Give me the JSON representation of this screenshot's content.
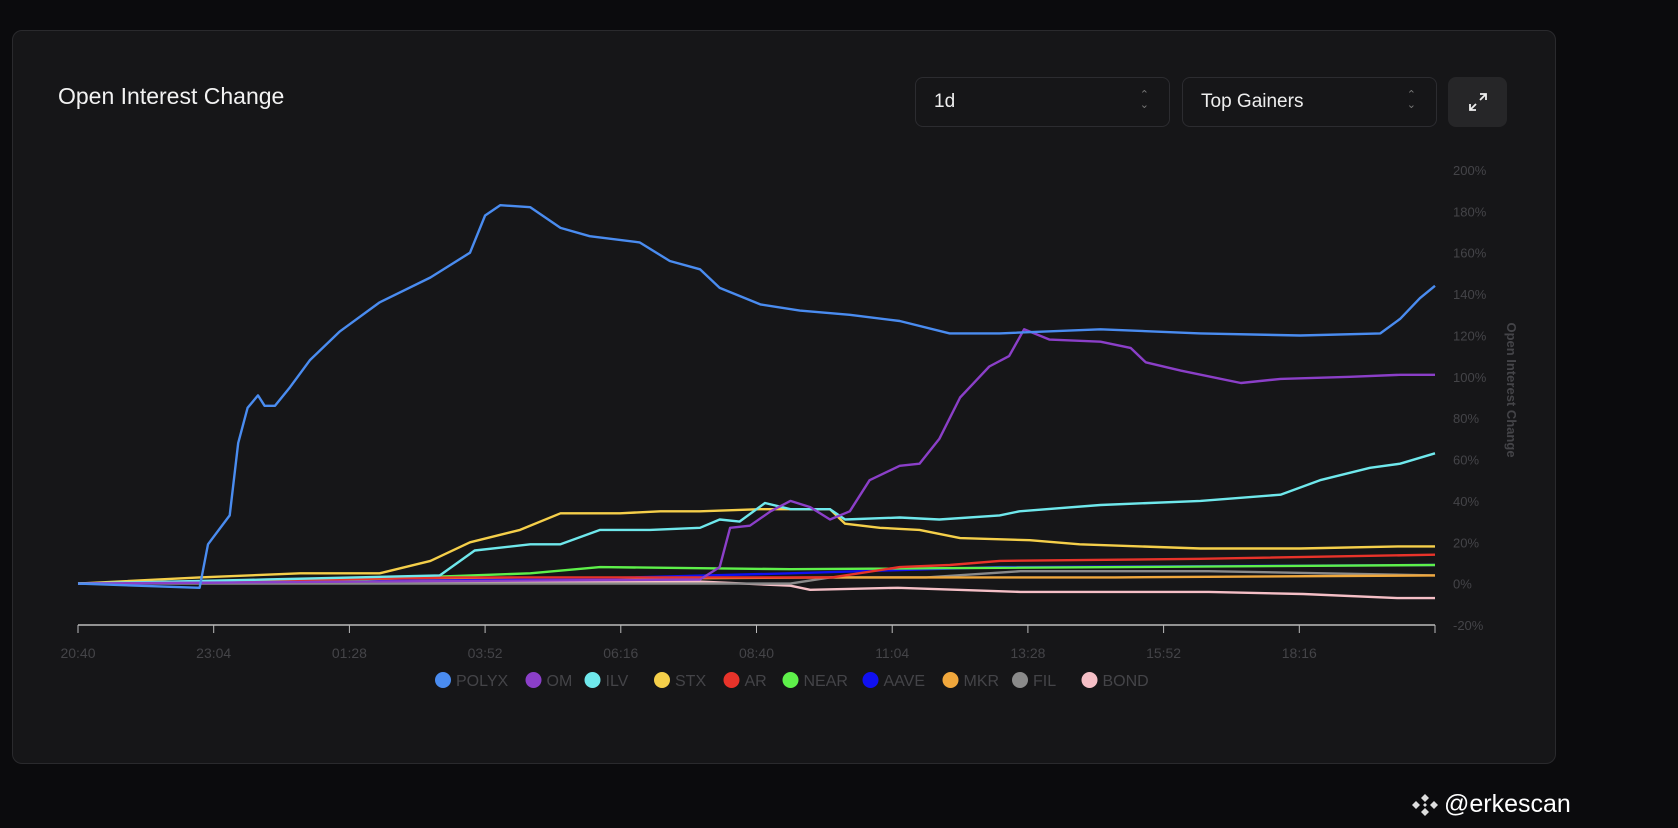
{
  "title": "Open Interest Change",
  "controls": {
    "timeframe": "1d",
    "filter": "Top Gainers"
  },
  "watermark": "@erkescan",
  "chart_data": {
    "type": "line",
    "title": "Open Interest Change",
    "ylabel": "Open Interest Change",
    "ylim": [
      -20,
      200
    ],
    "yticks": [
      "-20%",
      "0%",
      "20%",
      "40%",
      "60%",
      "80%",
      "100%",
      "120%",
      "140%",
      "160%",
      "180%",
      "200%"
    ],
    "xticks": [
      "20:40",
      "23:04",
      "01:28",
      "03:52",
      "06:16",
      "08:40",
      "11:04",
      "13:28",
      "15:52",
      "18:16"
    ],
    "xrange_minutes": [
      0,
      1440
    ],
    "legend_position": "bottom",
    "series": [
      {
        "name": "POLYX",
        "color": "#4a8cf0",
        "points": [
          [
            0,
            0
          ],
          [
            129,
            -2
          ],
          [
            138,
            19
          ],
          [
            161,
            33
          ],
          [
            170,
            68
          ],
          [
            180,
            85
          ],
          [
            191,
            91
          ],
          [
            198,
            86
          ],
          [
            209,
            86
          ],
          [
            225,
            95
          ],
          [
            246,
            108
          ],
          [
            278,
            122
          ],
          [
            320,
            136
          ],
          [
            374,
            148
          ],
          [
            416,
            160
          ],
          [
            432,
            178
          ],
          [
            448,
            183
          ],
          [
            480,
            182
          ],
          [
            512,
            172
          ],
          [
            543,
            168
          ],
          [
            596,
            165
          ],
          [
            628,
            156
          ],
          [
            660,
            152
          ],
          [
            681,
            143
          ],
          [
            724,
            135
          ],
          [
            766,
            132
          ],
          [
            819,
            130
          ],
          [
            872,
            127
          ],
          [
            925,
            121
          ],
          [
            978,
            121
          ],
          [
            1085,
            123
          ],
          [
            1191,
            121
          ],
          [
            1297,
            120
          ],
          [
            1382,
            121
          ],
          [
            1403,
            128
          ],
          [
            1424,
            138
          ],
          [
            1440,
            144
          ]
        ]
      },
      {
        "name": "OM",
        "color": "#8b3fc8",
        "points": [
          [
            0,
            0
          ],
          [
            300,
            1
          ],
          [
            660,
            2
          ],
          [
            681,
            8
          ],
          [
            692,
            27
          ],
          [
            713,
            28
          ],
          [
            735,
            35
          ],
          [
            756,
            40
          ],
          [
            777,
            37
          ],
          [
            798,
            31
          ],
          [
            819,
            35
          ],
          [
            840,
            50
          ],
          [
            872,
            57
          ],
          [
            893,
            58
          ],
          [
            914,
            70
          ],
          [
            936,
            90
          ],
          [
            967,
            105
          ],
          [
            988,
            110
          ],
          [
            1004,
            123
          ],
          [
            1031,
            118
          ],
          [
            1085,
            117
          ],
          [
            1117,
            114
          ],
          [
            1133,
            107
          ],
          [
            1170,
            103
          ],
          [
            1234,
            97
          ],
          [
            1276,
            99
          ],
          [
            1350,
            100
          ],
          [
            1403,
            101
          ],
          [
            1440,
            101
          ]
        ]
      },
      {
        "name": "ILV",
        "color": "#6fe8ec",
        "points": [
          [
            0,
            0
          ],
          [
            200,
            2
          ],
          [
            384,
            4
          ],
          [
            421,
            16
          ],
          [
            480,
            19
          ],
          [
            512,
            19
          ],
          [
            554,
            26
          ],
          [
            607,
            26
          ],
          [
            660,
            27
          ],
          [
            681,
            31
          ],
          [
            702,
            30
          ],
          [
            729,
            39
          ],
          [
            756,
            36
          ],
          [
            798,
            36
          ],
          [
            814,
            31
          ],
          [
            872,
            32
          ],
          [
            914,
            31
          ],
          [
            978,
            33
          ],
          [
            999,
            35
          ],
          [
            1085,
            38
          ],
          [
            1191,
            40
          ],
          [
            1276,
            43
          ],
          [
            1318,
            50
          ],
          [
            1371,
            56
          ],
          [
            1403,
            58
          ],
          [
            1440,
            63
          ]
        ]
      },
      {
        "name": "STX",
        "color": "#f5cf4a",
        "points": [
          [
            0,
            0
          ],
          [
            129,
            3
          ],
          [
            236,
            5
          ],
          [
            320,
            5
          ],
          [
            374,
            11
          ],
          [
            416,
            20
          ],
          [
            469,
            26
          ],
          [
            512,
            34
          ],
          [
            575,
            34
          ],
          [
            618,
            35
          ],
          [
            660,
            35
          ],
          [
            724,
            36
          ],
          [
            798,
            36
          ],
          [
            814,
            29
          ],
          [
            851,
            27
          ],
          [
            893,
            26
          ],
          [
            936,
            22
          ],
          [
            1010,
            21
          ],
          [
            1063,
            19
          ],
          [
            1191,
            17
          ],
          [
            1297,
            17
          ],
          [
            1403,
            18
          ],
          [
            1440,
            18
          ]
        ]
      },
      {
        "name": "AR",
        "color": "#e8332a",
        "points": [
          [
            0,
            0
          ],
          [
            400,
            3
          ],
          [
            800,
            3
          ],
          [
            872,
            8
          ],
          [
            925,
            9
          ],
          [
            978,
            11
          ],
          [
            1191,
            12
          ],
          [
            1440,
            14
          ]
        ]
      },
      {
        "name": "NEAR",
        "color": "#5ef04a",
        "points": [
          [
            0,
            0
          ],
          [
            300,
            2
          ],
          [
            480,
            5
          ],
          [
            554,
            8
          ],
          [
            756,
            7
          ],
          [
            1440,
            9
          ]
        ]
      },
      {
        "name": "AAVE",
        "color": "#1010f0",
        "points": [
          [
            0,
            0
          ],
          [
            500,
            2
          ],
          [
            756,
            5
          ],
          [
            978,
            8
          ],
          [
            1440,
            9
          ]
        ]
      },
      {
        "name": "MKR",
        "color": "#f0a73c",
        "points": [
          [
            0,
            0
          ],
          [
            400,
            2
          ],
          [
            800,
            3
          ],
          [
            1100,
            3
          ],
          [
            1440,
            4
          ]
        ]
      },
      {
        "name": "FIL",
        "color": "#8a8a8a",
        "points": [
          [
            0,
            0
          ],
          [
            500,
            0
          ],
          [
            756,
            0
          ],
          [
            798,
            3
          ],
          [
            900,
            3
          ],
          [
            1000,
            6
          ],
          [
            1200,
            6
          ],
          [
            1440,
            4
          ]
        ]
      },
      {
        "name": "BOND",
        "color": "#f5bfc6",
        "points": [
          [
            0,
            0
          ],
          [
            400,
            1
          ],
          [
            660,
            1
          ],
          [
            756,
            -1
          ],
          [
            777,
            -3
          ],
          [
            870,
            -2
          ],
          [
            1000,
            -4
          ],
          [
            1200,
            -4
          ],
          [
            1300,
            -5
          ],
          [
            1400,
            -7
          ],
          [
            1440,
            -7
          ]
        ]
      }
    ]
  }
}
